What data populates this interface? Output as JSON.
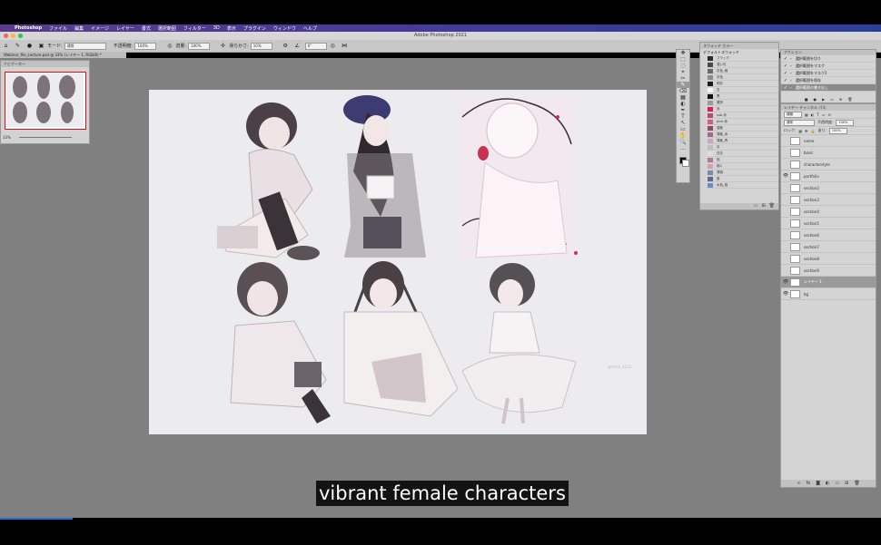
{
  "menubar": {
    "apple": "",
    "app": "Photoshop",
    "items": [
      "ファイル",
      "編集",
      "イメージ",
      "レイヤー",
      "書式",
      "選択範囲",
      "フィルター",
      "3D",
      "表示",
      "プラグイン",
      "ウィンドウ",
      "ヘルプ"
    ]
  },
  "titlebar": {
    "title": "Adobe Photoshop 2021",
    "dot_colors": [
      "#ff5f57",
      "#febc2e",
      "#28c840"
    ]
  },
  "optbar": {
    "mode_label": "モード:",
    "mode_value": "通常",
    "opacity_label": "不透明度:",
    "opacity_value": "100%",
    "flow_label": "流量:",
    "flow_value": "100%",
    "smooth_label": "滑らかさ:",
    "smooth_value": "10%",
    "angle_value": "0°"
  },
  "doctab": {
    "label": "Webinar_file_Lecture.psd @ 33% (レイヤー 1, RGB/8) *"
  },
  "navigator": {
    "title": "ナビゲーター",
    "zoom": "33%"
  },
  "tools": [
    "✥",
    "⬚",
    "◌",
    "⌖",
    "✂",
    "✎",
    "⌫",
    "▦",
    "◐",
    "✒",
    "T",
    "↖",
    "▭",
    "✋",
    "🔍",
    "…"
  ],
  "swatches": {
    "tabs": "スウォッチ  カラー",
    "group": "デフォルトスウォッチ",
    "rows": [
      {
        "name": "ブラック",
        "color": "#2a2a2a"
      },
      {
        "name": "濃い灰",
        "color": "#4a4a4a"
      },
      {
        "name": "灰色_暗",
        "color": "#6a6a6a"
      },
      {
        "name": "灰色",
        "color": "#8c8c8c"
      },
      {
        "name": "明灰",
        "color": "#1a1a1a"
      },
      {
        "name": "白",
        "color": "#f4f4f4"
      },
      {
        "name": "黒",
        "color": "#111111"
      },
      {
        "name": "選択",
        "color": "#9a9a9a"
      },
      {
        "name": "赤",
        "color": "#d81e4a"
      },
      {
        "name": "sub 赤",
        "color": "#b34c6e"
      },
      {
        "name": "pink 赤",
        "color": "#cf5f7f"
      },
      {
        "name": "濃紫",
        "color": "#8a4a6e"
      },
      {
        "name": "薄紫_赤",
        "color": "#a06a86"
      },
      {
        "name": "薄紫_青",
        "color": "#c7a8bd"
      },
      {
        "name": "灰",
        "color": "#bdbdbd"
      },
      {
        "name": "白灰",
        "color": "#dddddd"
      },
      {
        "name": "桃",
        "color": "#b07a90"
      },
      {
        "name": "桃2",
        "color": "#d4a0b4"
      },
      {
        "name": "薄桃",
        "color": "#7a8bb0"
      },
      {
        "name": "藍",
        "color": "#5a6a90"
      },
      {
        "name": "水色_桃",
        "color": "#6a8ad0"
      }
    ]
  },
  "actions": {
    "title": "アクション",
    "items": [
      "選択範囲を切り",
      "選択範囲をマスク",
      "選択範囲をマスク2",
      "選択範囲を保存",
      "選択範囲の書き出し"
    ]
  },
  "layers": {
    "tabs": "レイヤー  チャンネル  パス",
    "filter": "種類",
    "blend": "通常",
    "opacity_label": "不透明度:",
    "opacity": "100%",
    "lock_label": "ロック:",
    "fill_label": "塗り:",
    "fill": "100%",
    "items": [
      {
        "name": "name",
        "visible": false,
        "selected": false
      },
      {
        "name": "basic",
        "visible": false,
        "selected": false
      },
      {
        "name": "characterstyle",
        "visible": false,
        "selected": false
      },
      {
        "name": "portfolio",
        "visible": true,
        "selected": false
      },
      {
        "name": "section2",
        "visible": false,
        "selected": false
      },
      {
        "name": "section3",
        "visible": false,
        "selected": false
      },
      {
        "name": "section4",
        "visible": false,
        "selected": false
      },
      {
        "name": "section5",
        "visible": false,
        "selected": false
      },
      {
        "name": "section6",
        "visible": false,
        "selected": false
      },
      {
        "name": "section7",
        "visible": false,
        "selected": false
      },
      {
        "name": "section8",
        "visible": false,
        "selected": false
      },
      {
        "name": "section9",
        "visible": false,
        "selected": false
      },
      {
        "name": "レイヤー 1",
        "visible": true,
        "selected": true
      },
      {
        "name": "bg",
        "visible": true,
        "selected": false
      }
    ]
  },
  "canvas": {
    "background": "#ecebee",
    "accent": "#c8324e",
    "watermark": "@hiten_1222"
  },
  "caption": {
    "text": "vibrant female characters"
  }
}
